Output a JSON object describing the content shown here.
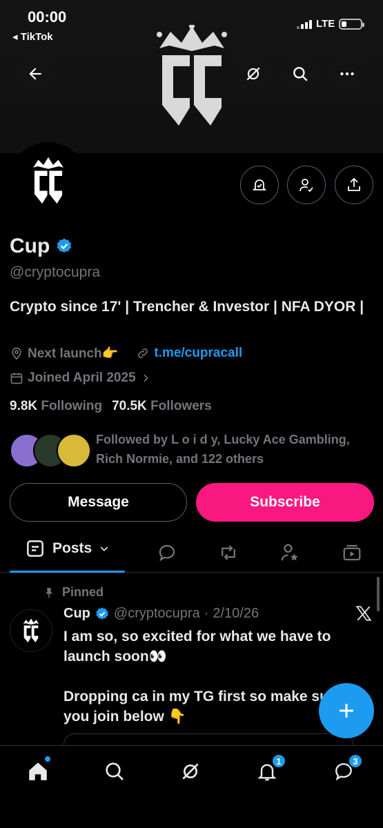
{
  "status_bar": {
    "time": "00:00",
    "back_app": "◂ TikTok",
    "network": "LTE"
  },
  "profile": {
    "name": "Cup",
    "handle": "@cryptocupra",
    "bio": "Crypto since 17' | Trencher & Investor | NFA DYOR |",
    "location": "Next launch👉",
    "link": "t.me/cupracall",
    "joined": "Joined April 2025",
    "following_count": "9.8K",
    "following_label": "Following",
    "followers_count": "70.5K",
    "followers_label": "Followers",
    "followed_by": "Followed by L o i d y, Lucky Ace Gambling, Rich Normie, and 122 others"
  },
  "actions": {
    "message_label": "Message",
    "subscribe_label": "Subscribe"
  },
  "tabs": {
    "posts_label": "Posts"
  },
  "pinned_post": {
    "pinned_label": "Pinned",
    "author_name": "Cup",
    "author_handle": "@cryptocupra",
    "separator": "·",
    "date": "2/10/26",
    "text": "I am so, so excited for what we have to launch soon👀\n\nDropping ca in my TG first so make sure you join below 👇"
  },
  "nav": {
    "notifications_badge": "1",
    "messages_badge": "3"
  },
  "colors": {
    "accent": "#1d9bf0",
    "subscribe": "#f91880",
    "verified": "#1d9bf0"
  },
  "icons": [
    "back-arrow-icon",
    "grok-icon",
    "search-icon",
    "more-icon",
    "notification-bell-icon",
    "follow-check-icon",
    "share-icon",
    "verified-icon",
    "location-icon",
    "link-icon",
    "calendar-icon",
    "chevron-right-icon",
    "posts-icon",
    "replies-icon",
    "reposts-icon",
    "highlights-icon",
    "media-icon",
    "pin-icon",
    "x-logo-icon",
    "compose-plus-icon",
    "home-icon",
    "explore-icon",
    "grok-nav-icon",
    "bell-icon",
    "messages-icon"
  ]
}
